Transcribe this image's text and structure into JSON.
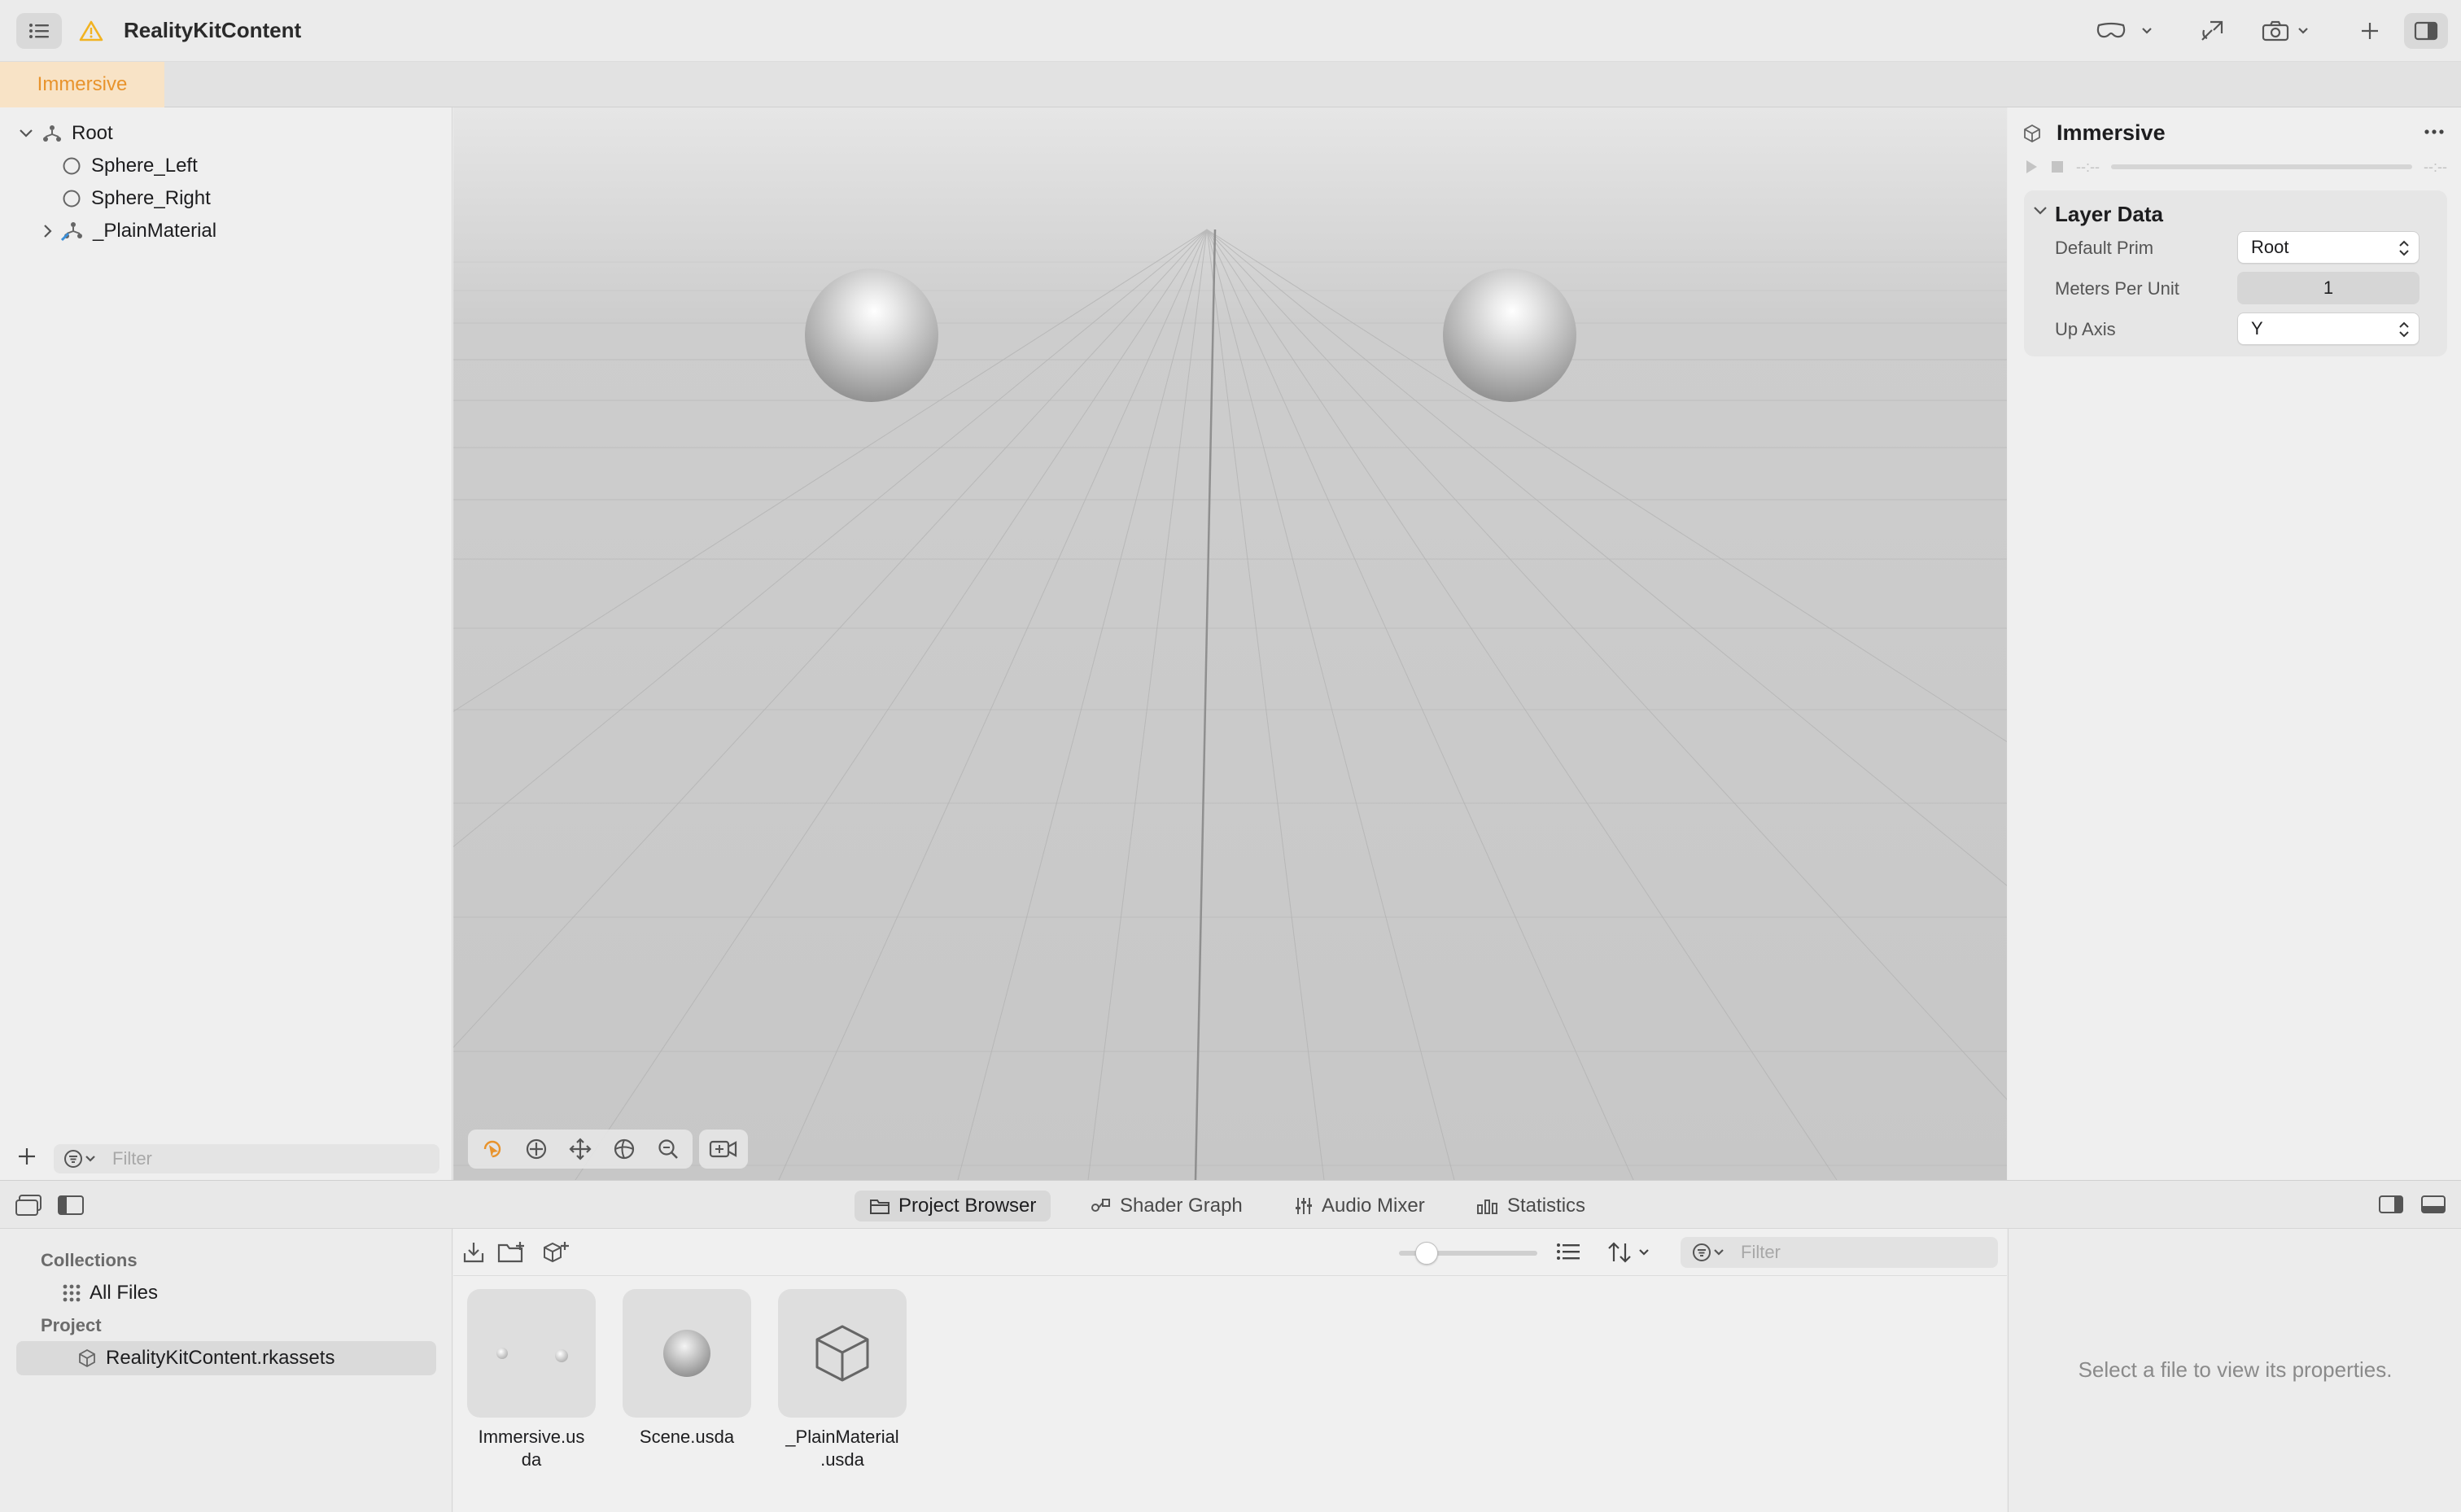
{
  "window": {
    "title": "RealityKitContent",
    "colors": {
      "accent": "#e8932c",
      "warning": "#f2b321"
    }
  },
  "tabs": [
    {
      "label": "Immersive",
      "active": true
    }
  ],
  "outline": {
    "items": [
      {
        "label": "Root",
        "icon": "hierarchy-icon",
        "expanded": true
      },
      {
        "label": "Sphere_Left",
        "icon": "sphere-outline-icon"
      },
      {
        "label": "Sphere_Right",
        "icon": "sphere-outline-icon"
      },
      {
        "label": "_PlainMaterial",
        "icon": "material-icon",
        "expanded": false
      }
    ],
    "filter_placeholder": "Filter"
  },
  "inspector": {
    "title": "Immersive",
    "transport": {
      "time_start": "--:--",
      "time_end": "--:--"
    },
    "section_title": "Layer Data",
    "properties": [
      {
        "label": "Default Prim",
        "value": "Root",
        "kind": "select"
      },
      {
        "label": "Meters Per Unit",
        "value": "1",
        "kind": "number"
      },
      {
        "label": "Up Axis",
        "value": "Y",
        "kind": "select"
      }
    ]
  },
  "bottom_tabs": [
    {
      "label": "Project Browser",
      "icon": "folder-icon",
      "active": true
    },
    {
      "label": "Shader Graph",
      "icon": "shader-graph-icon"
    },
    {
      "label": "Audio Mixer",
      "icon": "sliders-icon"
    },
    {
      "label": "Statistics",
      "icon": "bar-chart-icon"
    }
  ],
  "collections": {
    "section_collections": "Collections",
    "all_files": "All Files",
    "section_project": "Project",
    "project_item": "RealityKitContent.rkassets"
  },
  "browser": {
    "filter_placeholder": "Filter",
    "files": [
      {
        "name": "Immersive.usda",
        "display": "Immersive.us\nda",
        "thumb": "two-dots"
      },
      {
        "name": "Scene.usda",
        "display": "Scene.usda",
        "thumb": "sphere"
      },
      {
        "name": "_PlainMaterial.usda",
        "display": "_PlainMaterial\n.usda",
        "thumb": "cube"
      }
    ]
  },
  "file_properties": {
    "empty_message": "Select a file to view its properties."
  }
}
